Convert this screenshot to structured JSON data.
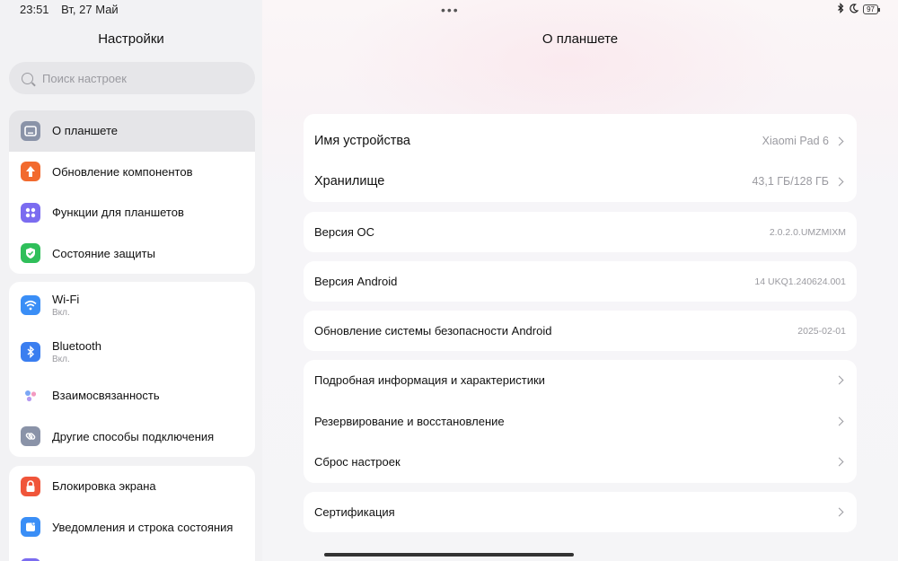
{
  "status": {
    "time": "23:51",
    "date": "Вт, 27 Май",
    "battery": "97",
    "dots": "•••"
  },
  "left": {
    "title": "Настройки",
    "search_placeholder": "Поиск настроек",
    "groups": [
      [
        {
          "label": "О планшете",
          "icon": "tablet-icon",
          "color": "#8a93a8",
          "selected": true
        },
        {
          "label": "Обновление компонентов",
          "icon": "arrow-up-icon",
          "color": "#f26a2e"
        },
        {
          "label": "Функции для планшетов",
          "icon": "grid-icon",
          "color": "#7b6cf0"
        },
        {
          "label": "Состояние защиты",
          "icon": "shield-check-icon",
          "color": "#2fbf5a"
        }
      ],
      [
        {
          "label": "Wi-Fi",
          "sub": "Вкл.",
          "icon": "wifi-icon",
          "color": "#3a8ef6"
        },
        {
          "label": "Bluetooth",
          "sub": "Вкл.",
          "icon": "bluetooth-icon",
          "color": "#3a7ef0"
        },
        {
          "label": "Взаимосвязанность",
          "icon": "dots-icon",
          "color": "#ffffff"
        },
        {
          "label": "Другие способы подключения",
          "icon": "link-icon",
          "color": "#8a93a8"
        }
      ],
      [
        {
          "label": "Блокировка экрана",
          "icon": "lock-icon",
          "color": "#f0553a"
        },
        {
          "label": "Уведомления и строка состояния",
          "icon": "notification-icon",
          "color": "#3a8ef6"
        }
      ]
    ]
  },
  "right": {
    "title": "О планшете",
    "device_name": {
      "label": "Имя устройства",
      "value": "Xiaomi Pad 6"
    },
    "storage": {
      "label": "Хранилище",
      "value": "43,1 ГБ/128 ГБ"
    },
    "os_version": {
      "label": "Версия ОС",
      "value": "2.0.2.0.UMZMIXM"
    },
    "android_version": {
      "label": "Версия Android",
      "value": "14 UKQ1.240624.001"
    },
    "security_update": {
      "label": "Обновление системы безопасности Android",
      "value": "2025-02-01"
    },
    "detailed_info": {
      "label": "Подробная информация и характеристики"
    },
    "backup": {
      "label": "Резервирование и восстановление"
    },
    "reset": {
      "label": "Сброс настроек"
    },
    "certification": {
      "label": "Сертификация"
    }
  }
}
